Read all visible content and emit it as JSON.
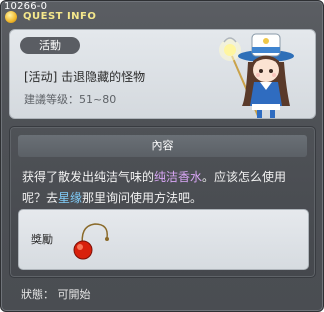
{
  "header": {
    "id_text": "10266-0",
    "title": "QUEST INFO"
  },
  "quest": {
    "category": "活動",
    "name": "[活动] 击退隐藏的怪物",
    "level": "建議等级：51~80"
  },
  "content": {
    "header": "內容",
    "line1_pre": "获得了散发出纯洁气味的",
    "line1_highlight": "纯洁香水",
    "line1_post": "。应该怎么使用",
    "line2_pre": "呢？去",
    "line2_highlight": "星缘",
    "line2_post": "那里询问使用方法吧。"
  },
  "reward": {
    "label": "獎勵",
    "item_icon": "red-orb-pendant"
  },
  "status": {
    "text": "狀態： 可開始"
  },
  "colors": {
    "highlight_purple": "#d8a6f5",
    "highlight_blue": "#80cdfa",
    "title_yellow": "#f5e88c"
  }
}
